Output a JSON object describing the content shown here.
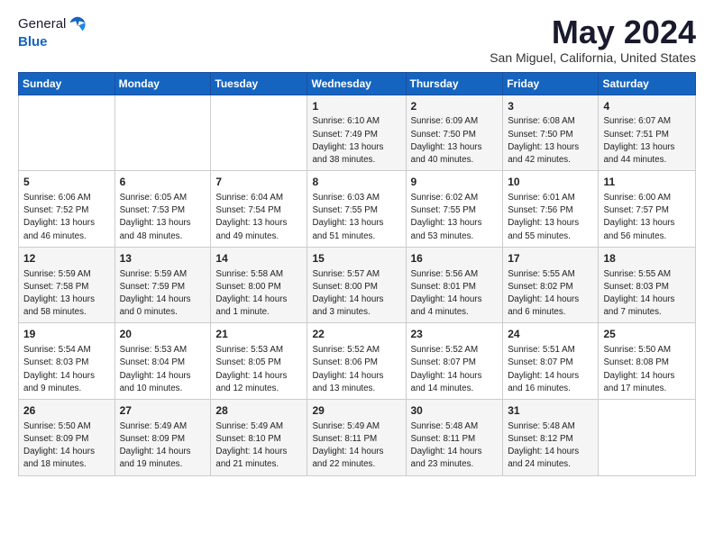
{
  "logo": {
    "line1": "General",
    "line2": "Blue",
    "icon_color": "#1565c0"
  },
  "title": "May 2024",
  "location": "San Miguel, California, United States",
  "days_of_week": [
    "Sunday",
    "Monday",
    "Tuesday",
    "Wednesday",
    "Thursday",
    "Friday",
    "Saturday"
  ],
  "weeks": [
    [
      {
        "day": "",
        "info": ""
      },
      {
        "day": "",
        "info": ""
      },
      {
        "day": "",
        "info": ""
      },
      {
        "day": "1",
        "info": "Sunrise: 6:10 AM\nSunset: 7:49 PM\nDaylight: 13 hours\nand 38 minutes."
      },
      {
        "day": "2",
        "info": "Sunrise: 6:09 AM\nSunset: 7:50 PM\nDaylight: 13 hours\nand 40 minutes."
      },
      {
        "day": "3",
        "info": "Sunrise: 6:08 AM\nSunset: 7:50 PM\nDaylight: 13 hours\nand 42 minutes."
      },
      {
        "day": "4",
        "info": "Sunrise: 6:07 AM\nSunset: 7:51 PM\nDaylight: 13 hours\nand 44 minutes."
      }
    ],
    [
      {
        "day": "5",
        "info": "Sunrise: 6:06 AM\nSunset: 7:52 PM\nDaylight: 13 hours\nand 46 minutes."
      },
      {
        "day": "6",
        "info": "Sunrise: 6:05 AM\nSunset: 7:53 PM\nDaylight: 13 hours\nand 48 minutes."
      },
      {
        "day": "7",
        "info": "Sunrise: 6:04 AM\nSunset: 7:54 PM\nDaylight: 13 hours\nand 49 minutes."
      },
      {
        "day": "8",
        "info": "Sunrise: 6:03 AM\nSunset: 7:55 PM\nDaylight: 13 hours\nand 51 minutes."
      },
      {
        "day": "9",
        "info": "Sunrise: 6:02 AM\nSunset: 7:55 PM\nDaylight: 13 hours\nand 53 minutes."
      },
      {
        "day": "10",
        "info": "Sunrise: 6:01 AM\nSunset: 7:56 PM\nDaylight: 13 hours\nand 55 minutes."
      },
      {
        "day": "11",
        "info": "Sunrise: 6:00 AM\nSunset: 7:57 PM\nDaylight: 13 hours\nand 56 minutes."
      }
    ],
    [
      {
        "day": "12",
        "info": "Sunrise: 5:59 AM\nSunset: 7:58 PM\nDaylight: 13 hours\nand 58 minutes."
      },
      {
        "day": "13",
        "info": "Sunrise: 5:59 AM\nSunset: 7:59 PM\nDaylight: 14 hours\nand 0 minutes."
      },
      {
        "day": "14",
        "info": "Sunrise: 5:58 AM\nSunset: 8:00 PM\nDaylight: 14 hours\nand 1 minute."
      },
      {
        "day": "15",
        "info": "Sunrise: 5:57 AM\nSunset: 8:00 PM\nDaylight: 14 hours\nand 3 minutes."
      },
      {
        "day": "16",
        "info": "Sunrise: 5:56 AM\nSunset: 8:01 PM\nDaylight: 14 hours\nand 4 minutes."
      },
      {
        "day": "17",
        "info": "Sunrise: 5:55 AM\nSunset: 8:02 PM\nDaylight: 14 hours\nand 6 minutes."
      },
      {
        "day": "18",
        "info": "Sunrise: 5:55 AM\nSunset: 8:03 PM\nDaylight: 14 hours\nand 7 minutes."
      }
    ],
    [
      {
        "day": "19",
        "info": "Sunrise: 5:54 AM\nSunset: 8:03 PM\nDaylight: 14 hours\nand 9 minutes."
      },
      {
        "day": "20",
        "info": "Sunrise: 5:53 AM\nSunset: 8:04 PM\nDaylight: 14 hours\nand 10 minutes."
      },
      {
        "day": "21",
        "info": "Sunrise: 5:53 AM\nSunset: 8:05 PM\nDaylight: 14 hours\nand 12 minutes."
      },
      {
        "day": "22",
        "info": "Sunrise: 5:52 AM\nSunset: 8:06 PM\nDaylight: 14 hours\nand 13 minutes."
      },
      {
        "day": "23",
        "info": "Sunrise: 5:52 AM\nSunset: 8:07 PM\nDaylight: 14 hours\nand 14 minutes."
      },
      {
        "day": "24",
        "info": "Sunrise: 5:51 AM\nSunset: 8:07 PM\nDaylight: 14 hours\nand 16 minutes."
      },
      {
        "day": "25",
        "info": "Sunrise: 5:50 AM\nSunset: 8:08 PM\nDaylight: 14 hours\nand 17 minutes."
      }
    ],
    [
      {
        "day": "26",
        "info": "Sunrise: 5:50 AM\nSunset: 8:09 PM\nDaylight: 14 hours\nand 18 minutes."
      },
      {
        "day": "27",
        "info": "Sunrise: 5:49 AM\nSunset: 8:09 PM\nDaylight: 14 hours\nand 19 minutes."
      },
      {
        "day": "28",
        "info": "Sunrise: 5:49 AM\nSunset: 8:10 PM\nDaylight: 14 hours\nand 21 minutes."
      },
      {
        "day": "29",
        "info": "Sunrise: 5:49 AM\nSunset: 8:11 PM\nDaylight: 14 hours\nand 22 minutes."
      },
      {
        "day": "30",
        "info": "Sunrise: 5:48 AM\nSunset: 8:11 PM\nDaylight: 14 hours\nand 23 minutes."
      },
      {
        "day": "31",
        "info": "Sunrise: 5:48 AM\nSunset: 8:12 PM\nDaylight: 14 hours\nand 24 minutes."
      },
      {
        "day": "",
        "info": ""
      }
    ]
  ]
}
